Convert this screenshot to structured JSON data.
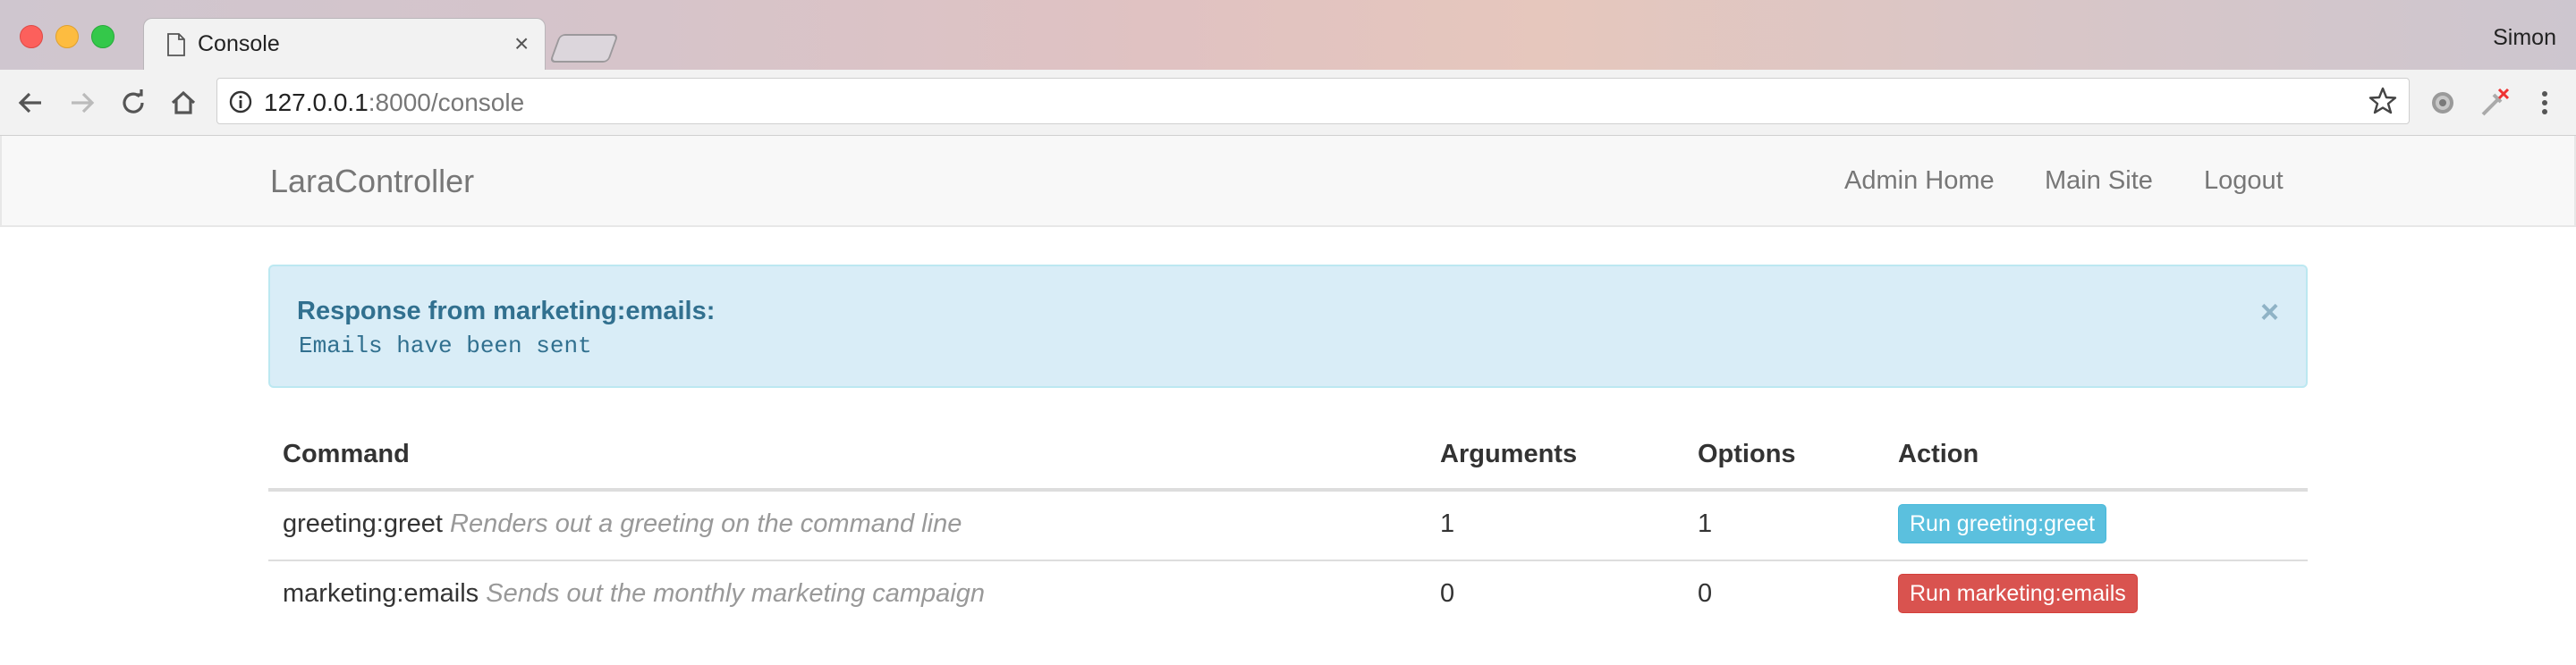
{
  "browser": {
    "tab_title": "Console",
    "tab_close": "×",
    "profile_name": "Simon",
    "url_host": "127.0.0.1",
    "url_rest": ":8000/console"
  },
  "navbar": {
    "brand": "LaraController",
    "links": [
      "Admin Home",
      "Main Site",
      "Logout"
    ]
  },
  "alert": {
    "title": "Response from marketing:emails:",
    "body": "Emails have been sent",
    "close": "×"
  },
  "table": {
    "headers": [
      "Command",
      "Arguments",
      "Options",
      "Action"
    ],
    "rows": [
      {
        "command": "greeting:greet",
        "description": "Renders out a greeting on the command line",
        "arguments": "1",
        "options": "1",
        "action": "Run greeting:greet",
        "action_color": "#5bc0de"
      },
      {
        "command": "marketing:emails",
        "description": "Sends out the monthly marketing campaign",
        "arguments": "0",
        "options": "0",
        "action": "Run marketing:emails",
        "action_color": "#d9534f"
      }
    ]
  },
  "icons": [
    "back-icon",
    "forward-icon",
    "reload-icon",
    "home-icon",
    "info-icon",
    "star-icon",
    "extension-gear-icon",
    "extension-tool-icon",
    "menu-icon",
    "document-icon"
  ]
}
